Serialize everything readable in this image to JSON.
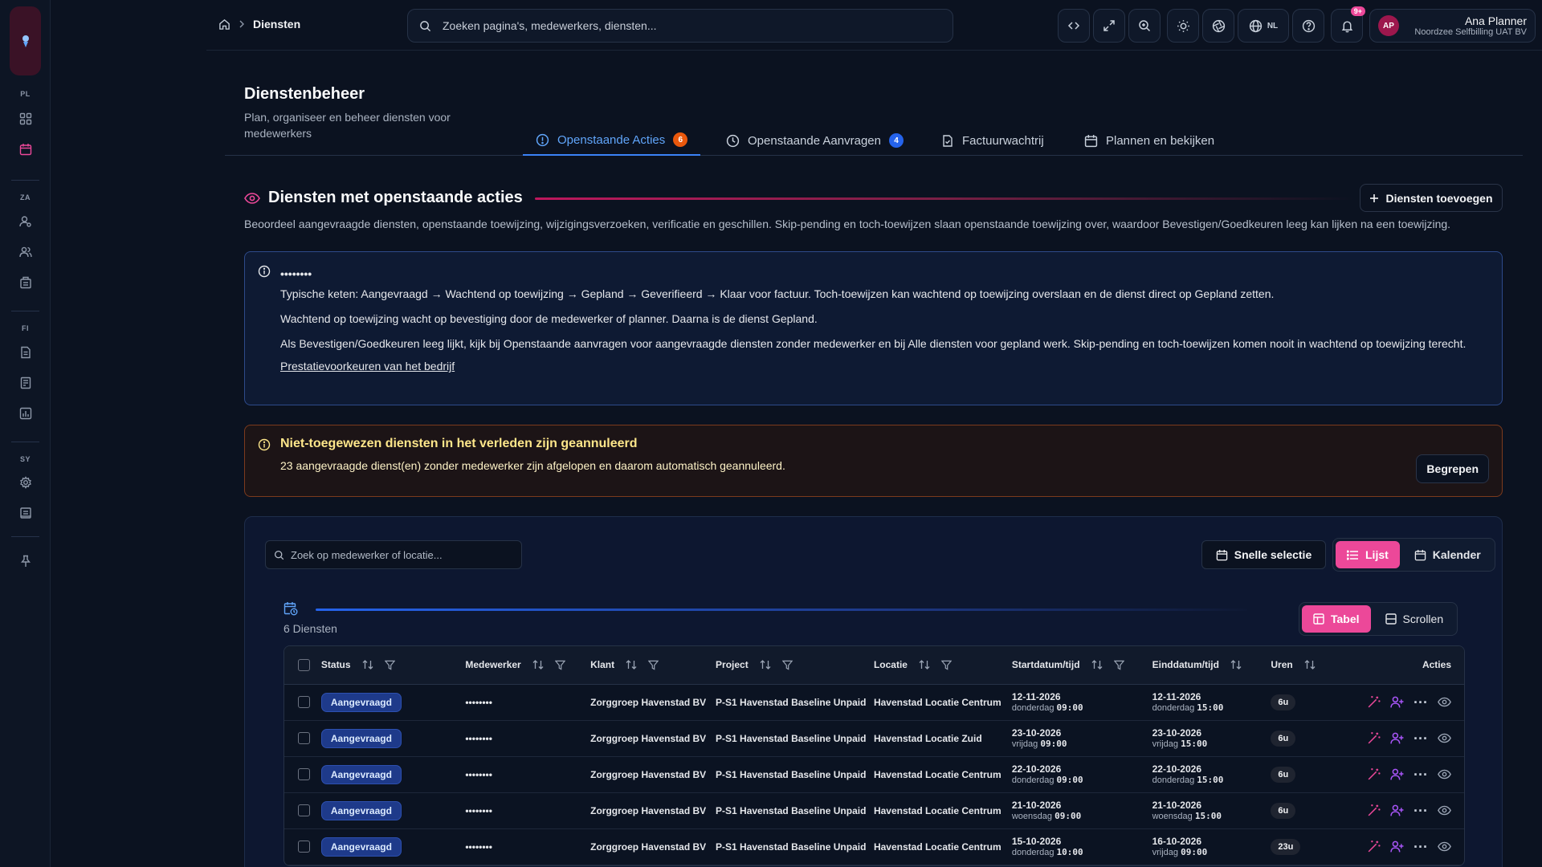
{
  "rail": {
    "sections": [
      "PL",
      "ZA",
      "FI",
      "SY"
    ]
  },
  "topbar": {
    "breadcrumb_current": "Diensten",
    "search_placeholder": "Zoeken pagina's, medewerkers, diensten...",
    "language": "NL",
    "notifications_badge": "9+",
    "user": {
      "initials": "AP",
      "name": "Ana Planner",
      "company": "Noordzee Selfbilling UAT BV"
    }
  },
  "page": {
    "title": "Dienstenbeheer",
    "subtitle": "Plan, organiseer en beheer diensten voor medewerkers",
    "tabs": [
      {
        "label": "Openstaande Acties",
        "count": "6"
      },
      {
        "label": "Openstaande Aanvragen",
        "count": "4"
      },
      {
        "label": "Factuurwachtrij"
      },
      {
        "label": "Plannen en bekijken"
      }
    ]
  },
  "section": {
    "title": "Diensten met openstaande acties",
    "add_button": "Diensten toevoegen",
    "description": "Beoordeel aangevraagde diensten, openstaande toewijzing, wijzigingsverzoeken, verificatie en geschillen. Skip-pending en toch-toewijzen slaan openstaande toewijzing over, waardoor Bevestigen/Goedkeuren leeg kan lijken na een toewijzing."
  },
  "info": {
    "title": "••••••••",
    "p1": "Typische keten: Aangevraagd → Wachtend op toewijzing → Gepland → Geverifieerd → Klaar voor factuur. Toch-toewijzen kan wachtend op toewijzing overslaan en de dienst direct op Gepland zetten.",
    "p2": "Wachtend op toewijzing wacht op bevestiging door de medewerker of planner. Daarna is de dienst Gepland.",
    "p3": "Als Bevestigen/Goedkeuren leeg lijkt, kijk bij Openstaande aanvragen voor aangevraagde diensten zonder medewerker en bij Alle diensten voor gepland werk. Skip-pending en toch-toewijzen komen nooit in wachtend op toewijzing terecht.",
    "link": "Prestatievoorkeuren van het bedrijf"
  },
  "warning": {
    "title": "Niet-toegewezen diensten in het verleden zijn geannuleerd",
    "desc": "23 aangevraagde dienst(en) zonder medewerker zijn afgelopen en daarom automatisch geannuleerd.",
    "button": "Begrepen"
  },
  "card": {
    "search_placeholder": "Zoek op medewerker of locatie...",
    "quick_select": "Snelle selectie",
    "view_list": "Lijst",
    "view_calendar": "Kalender",
    "count_label": "6 Diensten",
    "mode_table": "Tabel",
    "mode_scroll": "Scrollen"
  },
  "table": {
    "headers": {
      "status": "Status",
      "employee": "Medewerker",
      "client": "Klant",
      "project": "Project",
      "location": "Locatie",
      "start": "Startdatum/tijd",
      "end": "Einddatum/tijd",
      "hours": "Uren",
      "actions": "Acties"
    },
    "rows": [
      {
        "status": "Aangevraagd",
        "employee": "••••••••",
        "client": "Zorggroep Havenstad BV",
        "project": "P-S1 Havenstad Baseline Unpaid",
        "location": "Havenstad Locatie Centrum",
        "start_date": "12-11-2026",
        "start_day": "donderdag",
        "start_time": "09:00",
        "end_date": "12-11-2026",
        "end_day": "donderdag",
        "end_time": "15:00",
        "hours": "6u"
      },
      {
        "status": "Aangevraagd",
        "employee": "••••••••",
        "client": "Zorggroep Havenstad BV",
        "project": "P-S1 Havenstad Baseline Unpaid",
        "location": "Havenstad Locatie Zuid",
        "start_date": "23-10-2026",
        "start_day": "vrijdag",
        "start_time": "09:00",
        "end_date": "23-10-2026",
        "end_day": "vrijdag",
        "end_time": "15:00",
        "hours": "6u"
      },
      {
        "status": "Aangevraagd",
        "employee": "••••••••",
        "client": "Zorggroep Havenstad BV",
        "project": "P-S1 Havenstad Baseline Unpaid",
        "location": "Havenstad Locatie Centrum",
        "start_date": "22-10-2026",
        "start_day": "donderdag",
        "start_time": "09:00",
        "end_date": "22-10-2026",
        "end_day": "donderdag",
        "end_time": "15:00",
        "hours": "6u"
      },
      {
        "status": "Aangevraagd",
        "employee": "••••••••",
        "client": "Zorggroep Havenstad BV",
        "project": "P-S1 Havenstad Baseline Unpaid",
        "location": "Havenstad Locatie Centrum",
        "start_date": "21-10-2026",
        "start_day": "woensdag",
        "start_time": "09:00",
        "end_date": "21-10-2026",
        "end_day": "woensdag",
        "end_time": "15:00",
        "hours": "6u"
      },
      {
        "status": "Aangevraagd",
        "employee": "••••••••",
        "client": "Zorggroep Havenstad BV",
        "project": "P-S1 Havenstad Baseline Unpaid",
        "location": "Havenstad Locatie Centrum",
        "start_date": "15-10-2026",
        "start_day": "donderdag",
        "start_time": "10:00",
        "end_date": "16-10-2026",
        "end_day": "vrijdag",
        "end_time": "09:00",
        "hours": "23u"
      }
    ]
  },
  "colors": {
    "accent": "#ec4899",
    "primary": "#3b82f6",
    "warning_border": "#7c3a1d",
    "info_border": "#2d4a8a"
  }
}
